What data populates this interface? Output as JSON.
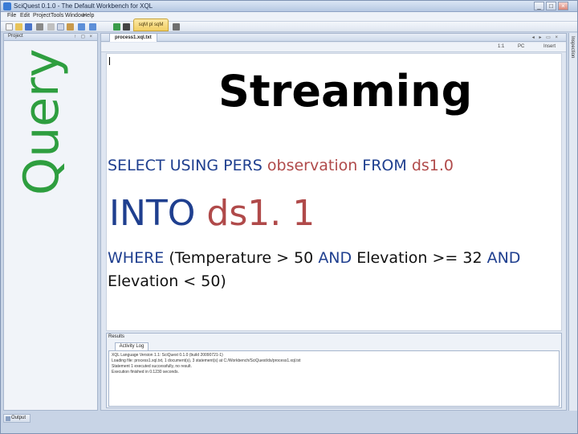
{
  "app": {
    "title": "SciQuest 0.1.0 - The Default Workbench for XQL",
    "window_buttons": {
      "minimize": "_",
      "maximize": "□",
      "close": "×"
    }
  },
  "menu": [
    "File",
    "Edit",
    "Project",
    "Tools",
    "Window",
    "Help"
  ],
  "toolbar": {
    "active_tab": "sqM pl sqM"
  },
  "project_panel": {
    "label": "Project",
    "controls": "↑ ◻ ×"
  },
  "editor": {
    "tab_label": "process1.xql.txt",
    "tab_controls": "◂ ▸ ▭ ×",
    "status": {
      "position": "1:1",
      "mode": "PC",
      "insert": "Insert"
    }
  },
  "results": {
    "label": "Results",
    "tab": "Activity Log",
    "log_lines": [
      "XQL Language Version 1.1: SciQuest 0.1.0 (build 20090721-1)",
      "Loading file: process1.xql.txt, 1 document(s), 3 statement(s) at C:/Workbench/SciQuest/ds/process1.xql.txt",
      "Statement 1 executed successfully, no result.",
      "Execution finished in 0.1230 seconds."
    ]
  },
  "inspection": {
    "label": "Inspection"
  },
  "output": {
    "label": "Output"
  },
  "slide": {
    "side_label": "Query",
    "title": "Streaming",
    "line1": {
      "k1": "SELECT USING PERS ",
      "v1": "observation",
      "k2": " FROM ",
      "v2": "ds1.0"
    },
    "line2": {
      "k1": "INTO ",
      "v1": "ds1. 1"
    },
    "line3": {
      "k1": "WHERE ",
      "v1": "(Temperature > 50 ",
      "k2": "AND ",
      "v2": "Elevation >= 32 ",
      "k3": "AND",
      "v3": "Elevation < 50)"
    }
  },
  "colors": {
    "keyword": "#1f3f8f",
    "highlight": "#b04a4a",
    "query_label": "#2e9e3f"
  }
}
